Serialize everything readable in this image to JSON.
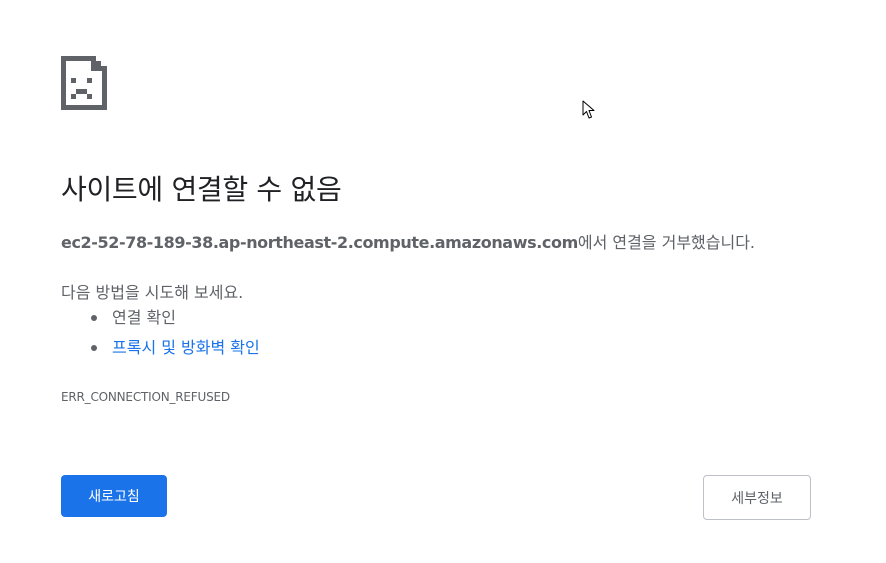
{
  "error": {
    "title": "사이트에 연결할 수 없음",
    "host": "ec2-52-78-189-38.ap-northeast-2.compute.amazonaws.com",
    "summary_suffix": "에서 연결을 거부했습니다.",
    "suggestions_heading": "다음 방법을 시도해 보세요.",
    "suggestions": [
      {
        "label": "연결 확인",
        "is_link": false
      },
      {
        "label": "프록시 및 방화벽 확인",
        "is_link": true
      }
    ],
    "code": "ERR_CONNECTION_REFUSED"
  },
  "buttons": {
    "reload_label": "새로고침",
    "details_label": "세부정보"
  },
  "icons": {
    "error": "sad-page-icon",
    "cursor": "mouse-pointer-icon"
  },
  "colors": {
    "primary": "#1a73e8",
    "text": "#5f6368",
    "title": "#202124",
    "icon": "#5f6368",
    "button_border": "#bdc1c6"
  }
}
